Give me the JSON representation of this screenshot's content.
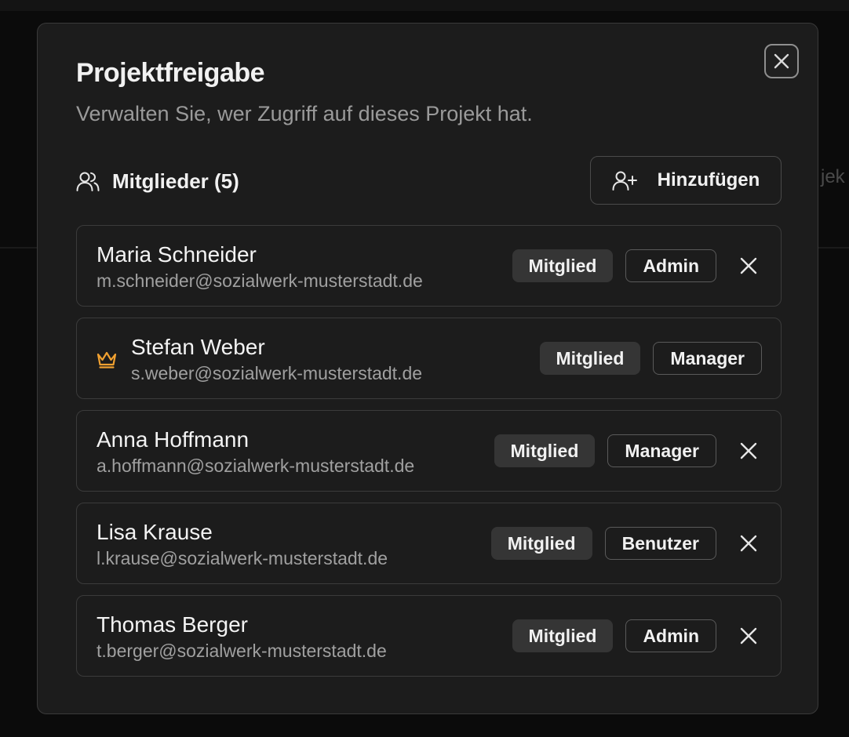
{
  "background": {
    "peek_text": "jek"
  },
  "modal": {
    "title": "Projektfreigabe",
    "subtitle": "Verwalten Sie, wer Zugriff auf dieses Projekt hat.",
    "close_icon": "close-icon",
    "members_heading": "Mitglieder (5)",
    "members_icon": "users-icon",
    "add_button": {
      "label": "Hinzufügen",
      "icon": "user-plus-icon"
    }
  },
  "members": [
    {
      "name": "Maria Schneider",
      "email": "m.schneider@sozialwerk-musterstadt.de",
      "status": "Mitglied",
      "role": "Admin",
      "owner": false,
      "removable": true
    },
    {
      "name": "Stefan Weber",
      "email": "s.weber@sozialwerk-musterstadt.de",
      "status": "Mitglied",
      "role": "Manager",
      "owner": true,
      "removable": false
    },
    {
      "name": "Anna Hoffmann",
      "email": "a.hoffmann@sozialwerk-musterstadt.de",
      "status": "Mitglied",
      "role": "Manager",
      "owner": false,
      "removable": true
    },
    {
      "name": "Lisa Krause",
      "email": "l.krause@sozialwerk-musterstadt.de",
      "status": "Mitglied",
      "role": "Benutzer",
      "owner": false,
      "removable": true
    },
    {
      "name": "Thomas Berger",
      "email": "t.berger@sozialwerk-musterstadt.de",
      "status": "Mitglied",
      "role": "Admin",
      "owner": false,
      "removable": true
    }
  ],
  "colors": {
    "accent_crown": "#f0a030",
    "modal_bg": "#1c1c1c",
    "badge_bg": "#353535"
  }
}
